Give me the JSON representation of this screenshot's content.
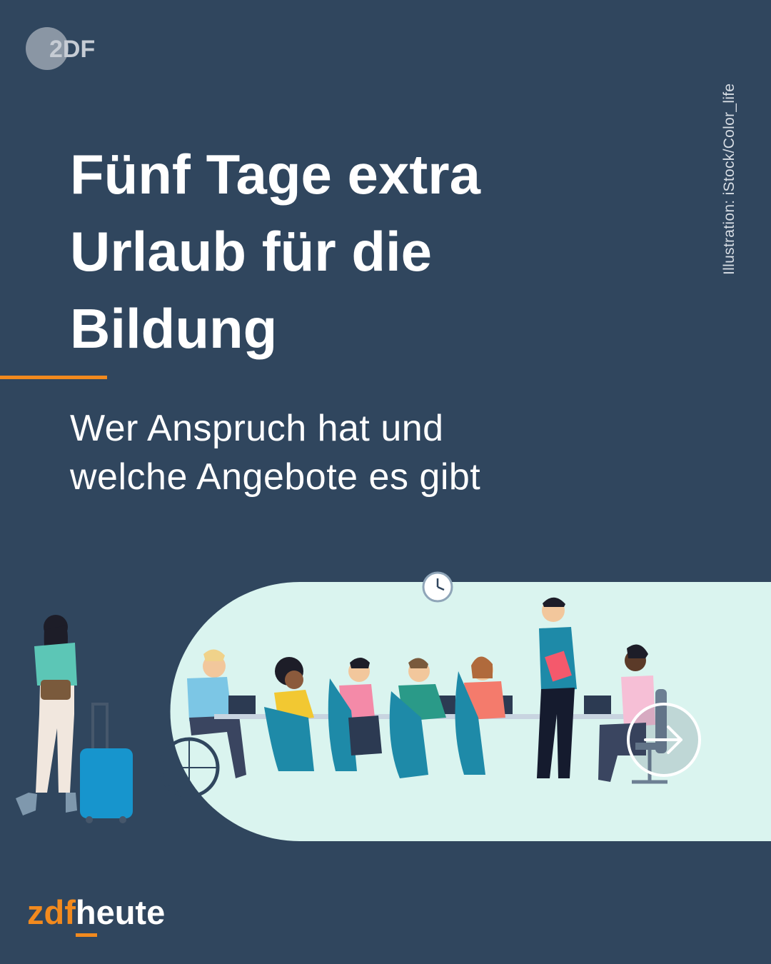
{
  "logo": {
    "text": "2DF"
  },
  "credit": "Illustration: iStock/Color_life",
  "headline": {
    "line1": "Fünf Tage extra",
    "line2": "Urlaub für die",
    "line3": "Bildung"
  },
  "subline": {
    "line1": "Wer Anspruch hat und",
    "line2": "welche Angebote es gibt"
  },
  "illustration": {
    "background_color": "#daf4ef",
    "icons": [
      "clock-icon",
      "traveler-with-suitcase",
      "meeting-table",
      "wheelchair-icon"
    ]
  },
  "next_button": {
    "icon": "arrow-right-icon"
  },
  "brand": {
    "zdf": "zdf",
    "heute": "heute"
  },
  "colors": {
    "background": "#30465e",
    "accent": "#f28a1e",
    "text": "#ffffff",
    "scene": "#daf4ef"
  }
}
